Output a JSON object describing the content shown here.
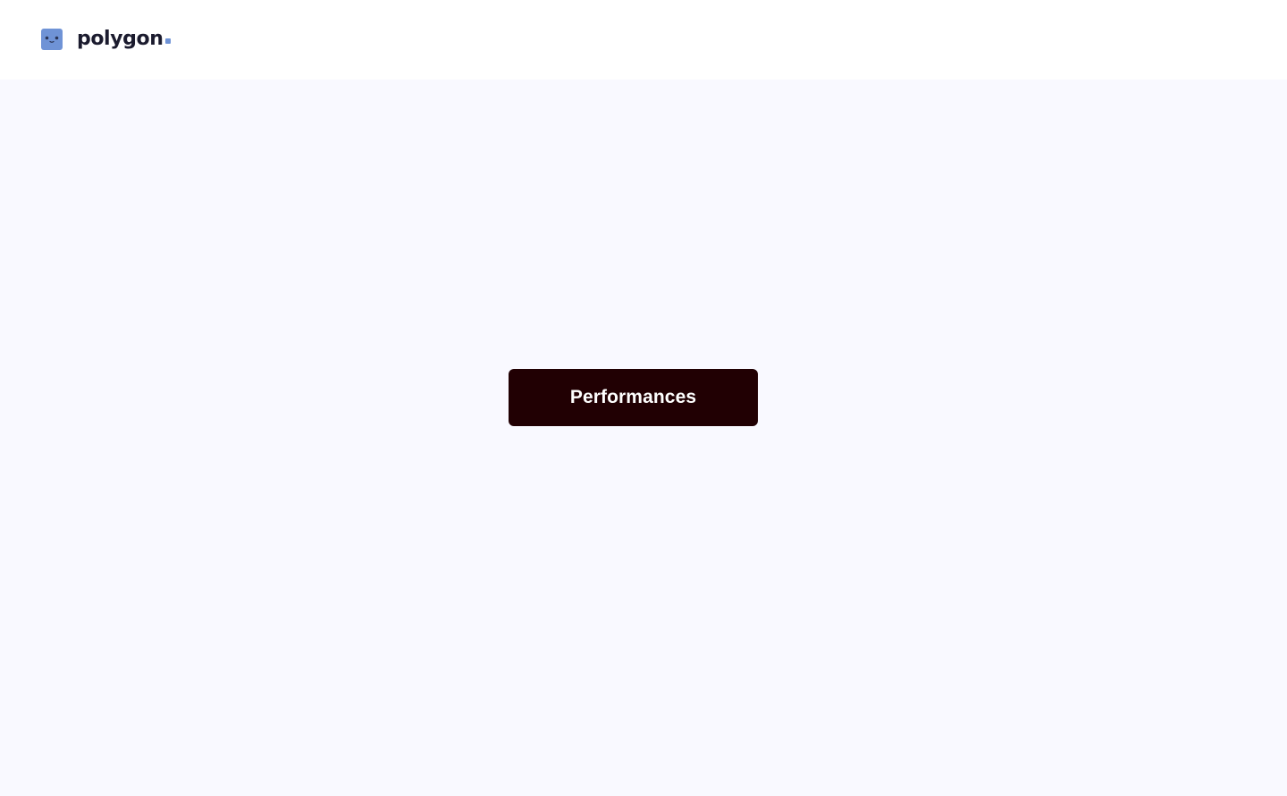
{
  "header": {
    "logo": {
      "icon": "cube-face-icon",
      "text": "polygon",
      "dot_icon": "square-dot-icon"
    }
  },
  "main": {
    "cta_label": "Performances"
  },
  "colors": {
    "brand_blue": "#6f93d6",
    "logo_eyes": "#2a3556",
    "wordmark": "#1b1b2e",
    "page_background": "#f9f9ff",
    "header_background": "#ffffff",
    "button_background": "#210003",
    "button_text": "#ffffff"
  }
}
